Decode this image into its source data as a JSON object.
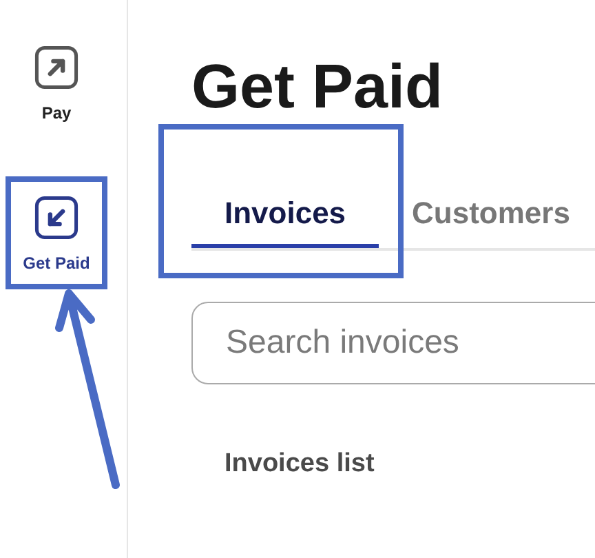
{
  "sidebar": {
    "items": [
      {
        "kind": "pay",
        "label": "Pay",
        "selected": false,
        "highlighted": false,
        "callout_arrow": false
      },
      {
        "kind": "get_paid",
        "label": "Get Paid",
        "selected": true,
        "highlighted": true,
        "callout_arrow": true
      }
    ]
  },
  "page": {
    "title": "Get Paid",
    "tabs": [
      {
        "label": "Invoices",
        "selected": true,
        "highlighted": true
      },
      {
        "label": "Customers",
        "selected": false,
        "highlighted": false
      }
    ],
    "search": {
      "placeholder": "Search invoices"
    },
    "section_title": "Invoices list"
  }
}
